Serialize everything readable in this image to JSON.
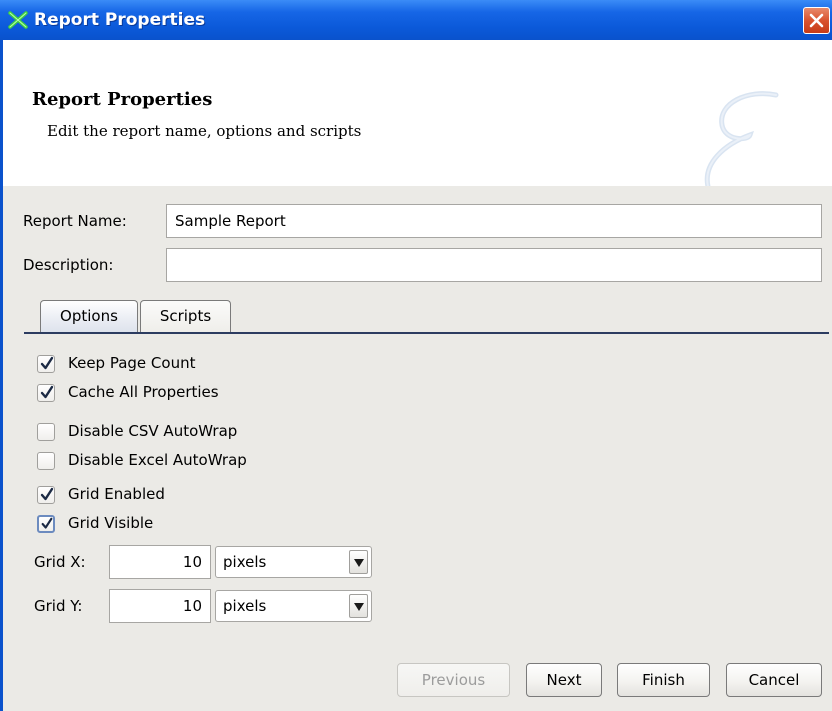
{
  "window": {
    "title": "Report Properties",
    "icon": "report-app-icon",
    "close_icon": "close-icon"
  },
  "header": {
    "title": "Report Properties",
    "description": "Edit the report name, options and scripts",
    "logo_letter": "E"
  },
  "form": {
    "report_name_label": "Report Name:",
    "report_name_value": "Sample Report",
    "description_label": "Description:",
    "description_value": ""
  },
  "tabs": [
    {
      "label": "Options",
      "active": true
    },
    {
      "label": "Scripts",
      "active": false
    }
  ],
  "options": {
    "checkboxes": [
      {
        "label": "Keep Page Count",
        "checked": true
      },
      {
        "label": "Cache All Properties",
        "checked": true
      },
      {
        "label": "Disable CSV AutoWrap",
        "checked": false
      },
      {
        "label": "Disable Excel AutoWrap",
        "checked": false
      },
      {
        "label": "Grid Enabled",
        "checked": true
      },
      {
        "label": "Grid Visible",
        "checked": true
      }
    ],
    "grid_x_label": "Grid X:",
    "grid_x_value": "10",
    "grid_x_unit": "pixels",
    "grid_y_label": "Grid Y:",
    "grid_y_value": "10",
    "grid_y_unit": "pixels"
  },
  "buttons": {
    "previous": "Previous",
    "next": "Next",
    "finish": "Finish",
    "cancel": "Cancel"
  },
  "colors": {
    "titlebar": "#0a52cc",
    "panel_bg": "#ebeae6",
    "tab_underline": "#2c3c60",
    "close_button": "#d9532f"
  }
}
